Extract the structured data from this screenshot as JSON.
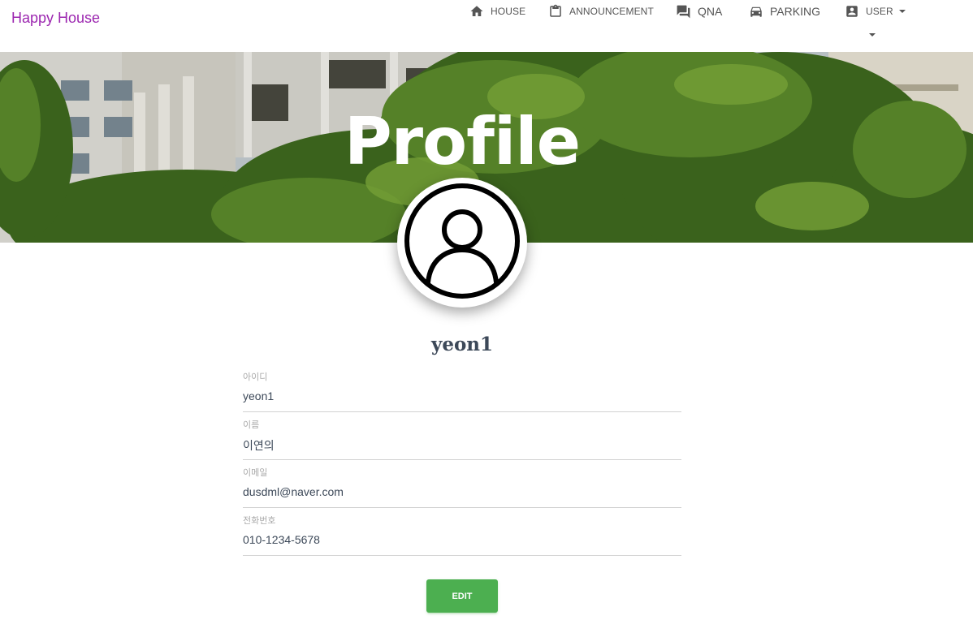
{
  "navbar": {
    "brand": "Happy House",
    "brand_color": "#9c27b0",
    "items": [
      {
        "label": "HOUSE",
        "icon": "home-icon"
      },
      {
        "label": "ANNOUNCEMENT",
        "icon": "clipboard-icon"
      },
      {
        "label": "QNA",
        "icon": "forum-icon"
      },
      {
        "label": "PARKING",
        "icon": "car-icon"
      },
      {
        "label": "USER",
        "icon": "account-box-icon"
      }
    ]
  },
  "hero": {
    "title": "Profile"
  },
  "profile": {
    "avatar_icon": "user-icon",
    "username": "yeon1",
    "fields": [
      {
        "label": "아이디",
        "value": "yeon1"
      },
      {
        "label": "이름",
        "value": "이연의"
      },
      {
        "label": "이메일",
        "value": "dusdml@naver.com"
      },
      {
        "label": "전화번호",
        "value": "010-1234-5678"
      }
    ]
  },
  "actions": {
    "edit_label": "EDIT",
    "edit_color": "#4caf50"
  }
}
